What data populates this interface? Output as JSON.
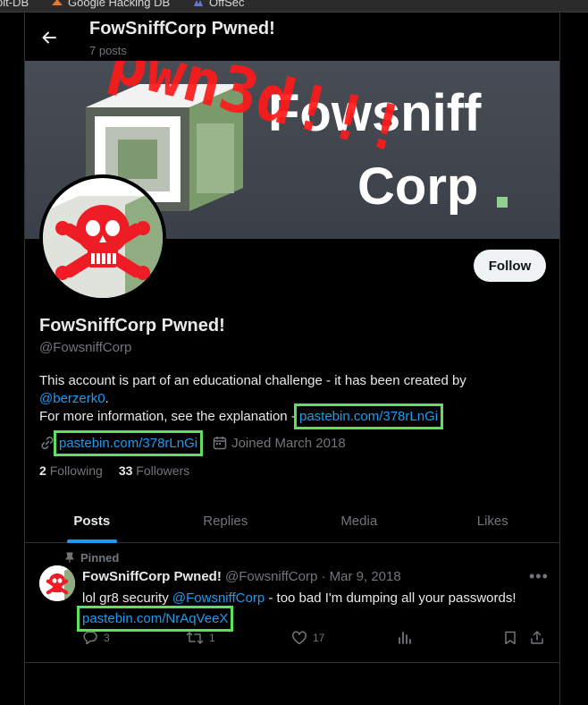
{
  "bookmarks": [
    {
      "label": "oit-DB",
      "icon": "bookmark-icon"
    },
    {
      "label": "Google Hacking DB",
      "icon": "exploitdb-icon"
    },
    {
      "label": "OffSec",
      "icon": "offsec-icon"
    }
  ],
  "header": {
    "title": "FowSniffCorp Pwned!",
    "post_count": "7 posts"
  },
  "banner": {
    "graffiti": "pwn3d!!!",
    "brand_line1": "Fowsniff",
    "brand_line2": "Corp"
  },
  "profile": {
    "follow_label": "Follow",
    "name": "FowSniffCorp Pwned!",
    "handle": "@FowsniffCorp",
    "bio_line1": "This account is part of an educational challenge - it has been created by",
    "bio_mention": "@berzerk0",
    "bio_period": ".",
    "bio_line2": "For more information, see the explanation - ",
    "bio_link": "pastebin.com/378rLnGi",
    "website": "pastebin.com/378rLnGi",
    "joined": "Joined March 2018",
    "following_count": "2",
    "following_label": "Following",
    "followers_count": "33",
    "followers_label": "Followers"
  },
  "tabs": [
    {
      "label": "Posts",
      "active": true
    },
    {
      "label": "Replies",
      "active": false
    },
    {
      "label": "Media",
      "active": false
    },
    {
      "label": "Likes",
      "active": false
    }
  ],
  "pinned_tweet": {
    "pinned_label": "Pinned",
    "author": "FowSniffCorp Pwned!",
    "handle": "@FowsniffCorp",
    "date": "· Mar 9, 2018",
    "text_before": "lol gr8 security ",
    "mention": "@FowsniffCorp",
    "text_after": " - too bad I'm dumping all your passwords!",
    "link": "pastebin.com/NrAqVeeX",
    "replies": "3",
    "reposts": "1",
    "likes": "17"
  },
  "colors": {
    "accent": "#1d9bf0",
    "highlight": "#5ee05e",
    "graffiti": "#ff1a1a",
    "background": "#000000"
  }
}
